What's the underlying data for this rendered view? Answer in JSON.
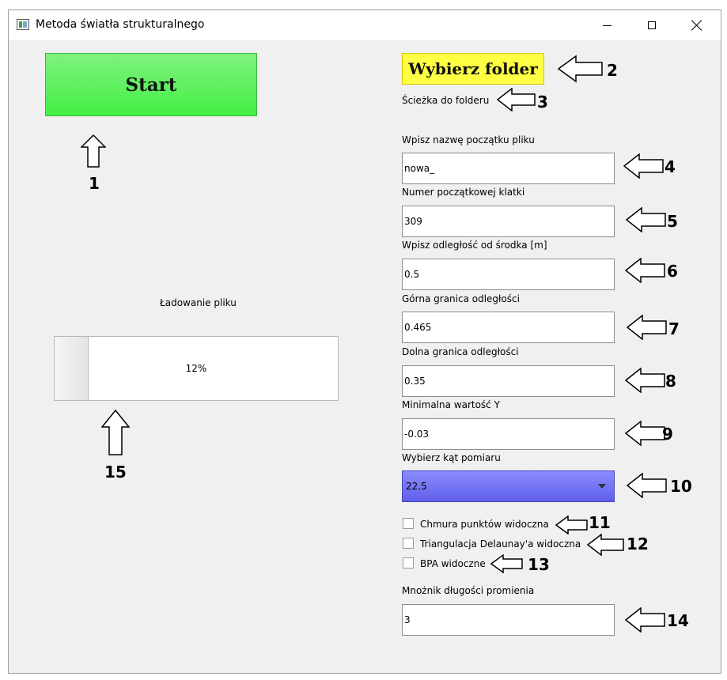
{
  "window": {
    "title": "Metoda światła strukturalnego"
  },
  "buttons": {
    "start": "Start",
    "choose_folder": "Wybierz folder"
  },
  "folder_path_label": "Ścieżka do folderu",
  "fields": [
    {
      "label": "Wpisz nazwę początku pliku",
      "value": "nowa_"
    },
    {
      "label": "Numer początkowej klatki",
      "value": "309"
    },
    {
      "label": "Wpisz odległość od środka [m]",
      "value": "0.5"
    },
    {
      "label": "Górna granica odległości",
      "value": "0.465"
    },
    {
      "label": "Dolna granica odległości",
      "value": "0.35"
    },
    {
      "label": "Minimalna wartość Y",
      "value": "-0.03"
    }
  ],
  "angle": {
    "label": "Wybierz kąt pomiaru",
    "selected": "22.5"
  },
  "checkboxes": [
    {
      "label": "Chmura punktów widoczna",
      "checked": false
    },
    {
      "label": "Triangulacja Delaunay'a widoczna",
      "checked": false
    },
    {
      "label": "BPA widoczne",
      "checked": false
    }
  ],
  "radius_multiplier": {
    "label": "Mnożnik długości promienia",
    "value": "3"
  },
  "loading": {
    "label": "Ładowanie pliku",
    "progress_text": "12%",
    "progress_fraction": 0.12
  },
  "annotations": [
    "1",
    "2",
    "3",
    "4",
    "5",
    "6",
    "7",
    "8",
    "9",
    "10",
    "11",
    "12",
    "13",
    "14",
    "15"
  ],
  "colors": {
    "start_button": "#55ee55",
    "folder_button": "#ffff44",
    "combo": "#7777f5"
  }
}
